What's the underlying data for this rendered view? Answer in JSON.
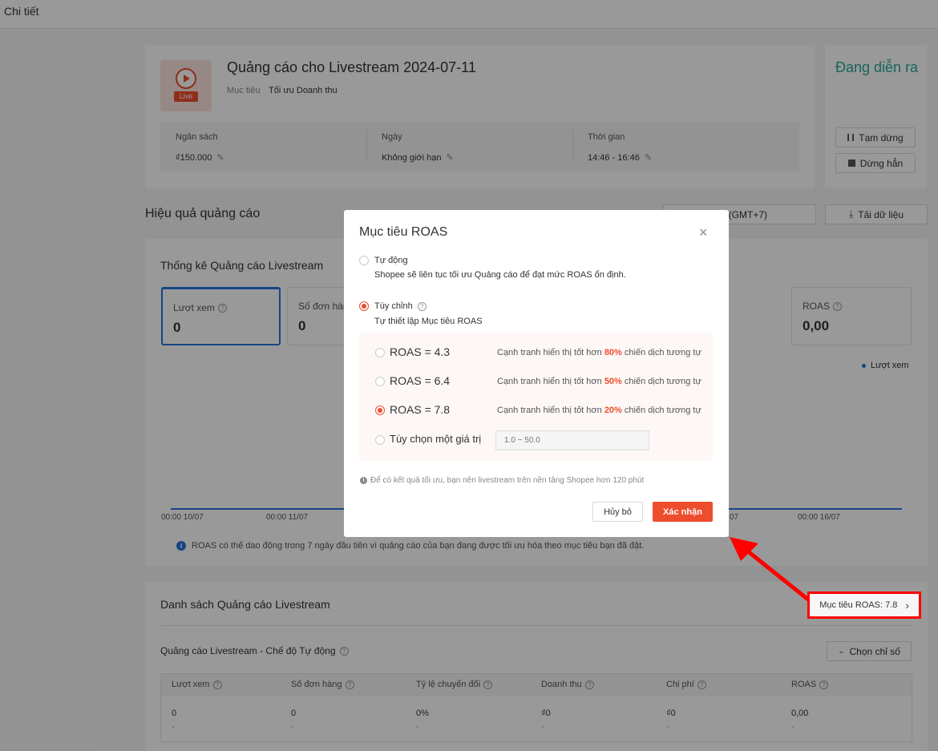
{
  "page": {
    "title": "Chi tiết"
  },
  "campaign": {
    "name": "Quảng cáo cho Livestream 2024-07-11",
    "goal_label": "Mục tiêu",
    "goal_value": "Tối ưu Doanh thu",
    "thumb_text": "Live",
    "budget_label": "Ngân sách",
    "budget_value": "₫150.000",
    "date_label": "Ngày",
    "date_value": "Không giới hạn",
    "time_label": "Thời gian",
    "time_value": "14:46 - 16:46"
  },
  "status": {
    "text": "Đang diễn ra",
    "pause_label": "Tạm dừng",
    "stop_label": "Dừng hẳn"
  },
  "performance": {
    "heading": "Hiệu quả quảng cáo",
    "timezone_label": "(GMT+7)",
    "download_label": "Tải dữ liệu",
    "stats_title": "Thống kê Quảng cáo Livestream",
    "stats": [
      {
        "label": "Lượt xem",
        "value": "0"
      },
      {
        "label": "Số đơn hàng",
        "value": "0"
      },
      {
        "label": "ROAS",
        "value": "0,00"
      }
    ],
    "legend": "Lượt xem",
    "x_ticks": [
      "00:00 10/07",
      "00:00 11/07",
      "07",
      "00:00 16/07"
    ],
    "note": "ROAS có thể dao động trong 7 ngày đầu tiên vì quảng cáo của bạn đang được tối ưu hóa theo mục tiêu bạn đã đặt."
  },
  "list": {
    "heading": "Danh sách Quảng cáo Livestream",
    "roas_target_label": "Mục tiêu ROAS: 7.8",
    "auto_mode_title": "Quảng cáo Livestream - Chế độ Tự động",
    "choose_metric_label": "Chọn chỉ số",
    "columns": [
      "Lượt xem",
      "Số đơn hàng",
      "Tỷ lệ chuyển đổi",
      "Doanh thu",
      "Chi phí",
      "ROAS"
    ],
    "row": [
      "0",
      "0",
      "0%",
      "₫0",
      "₫0",
      "0,00"
    ],
    "row_sub": [
      "-",
      "-",
      "-",
      "-",
      "-",
      "-"
    ]
  },
  "modal": {
    "title": "Mục tiêu ROAS",
    "auto_label": "Tự động",
    "auto_desc": "Shopee sẽ liên tục tối ưu Quảng cáo để đạt mức ROAS ổn định.",
    "custom_label": "Tùy chỉnh",
    "custom_desc": "Tự thiết lập Mục tiêu ROAS",
    "options": [
      {
        "label": "ROAS = 4.3",
        "desc_pre": "Cạnh tranh hiển thị tốt hơn ",
        "pct": "80%",
        "desc_post": " chiến dịch tương tự",
        "selected": false
      },
      {
        "label": "ROAS = 6.4",
        "desc_pre": "Cạnh tranh hiển thị tốt hơn ",
        "pct": "50%",
        "desc_post": " chiến dịch tương tự",
        "selected": false
      },
      {
        "label": "ROAS = 7.8",
        "desc_pre": "Cạnh tranh hiển thị tốt hơn ",
        "pct": "20%",
        "desc_post": " chiến dịch tương tự",
        "selected": true
      }
    ],
    "custom_value_label": "Tùy chọn một giá trị",
    "custom_value_placeholder": "1.0 ~ 50.0",
    "tip": "Để có kết quả tối ưu, bạn nên livestream trên nền tảng Shopee hơn 120 phút",
    "cancel_label": "Hủy bỏ",
    "confirm_label": "Xác nhận"
  },
  "colors": {
    "accent": "#ee4d2d",
    "status_green": "#26aa99",
    "annotation_red": "#ff0000",
    "chart_blue": "#2673dd"
  }
}
